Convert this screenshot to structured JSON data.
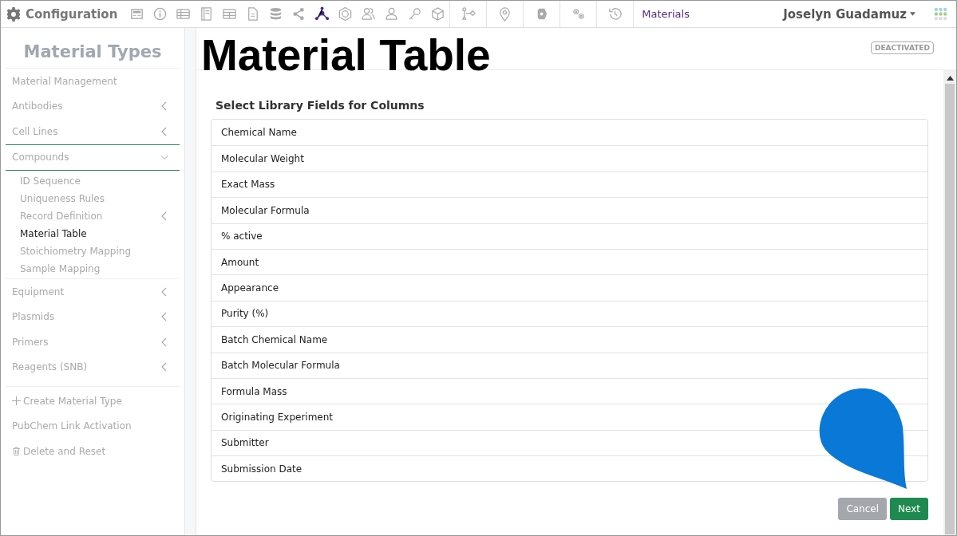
{
  "app_title": "Configuration",
  "toolbar": [
    {
      "selected": false
    },
    {
      "selected": false
    },
    {
      "selected": false
    },
    {
      "selected": false
    },
    {
      "selected": false
    },
    {
      "selected": false
    },
    {
      "selected": false
    },
    {
      "selected": false
    },
    {
      "selected": true
    },
    {
      "selected": false
    },
    {
      "selected": false
    },
    {
      "selected": false
    },
    {
      "selected": false
    },
    {
      "selected": false
    },
    {
      "selected": false
    },
    {
      "selected": false
    },
    {
      "selected": false
    },
    {
      "selected": false
    },
    {
      "selected": false
    }
  ],
  "breadcrumb": "Materials",
  "user": "Joselyn Guadamuz",
  "sidebar": {
    "title": "Material Types",
    "items": [
      {
        "label": "Material Management",
        "kind": "plain",
        "selected": false
      },
      {
        "label": "Antibodies",
        "kind": "group",
        "expanded": false,
        "selected": false
      },
      {
        "label": "Cell Lines",
        "kind": "group",
        "expanded": false,
        "selected": false
      },
      {
        "label": "Compounds",
        "kind": "group",
        "expanded": true,
        "selected": false,
        "children": [
          {
            "label": "ID Sequence",
            "kind": "plain",
            "selected": false
          },
          {
            "label": "Uniqueness Rules",
            "kind": "plain",
            "selected": false
          },
          {
            "label": "Record Definition",
            "kind": "group",
            "expanded": false,
            "selected": false
          },
          {
            "label": "Material Table",
            "kind": "plain",
            "selected": true
          },
          {
            "label": "Stoichiometry Mapping",
            "kind": "plain",
            "selected": false
          },
          {
            "label": "Sample Mapping",
            "kind": "plain",
            "selected": false
          }
        ]
      },
      {
        "label": "Equipment",
        "kind": "group",
        "expanded": false,
        "selected": false
      },
      {
        "label": "Plasmids",
        "kind": "group",
        "expanded": false,
        "selected": false
      },
      {
        "label": "Primers",
        "kind": "group",
        "expanded": false,
        "selected": false
      },
      {
        "label": "Reagents (SNB)",
        "kind": "group",
        "expanded": false,
        "selected": false
      }
    ],
    "actions": [
      {
        "label": "Create Material Type",
        "kind": "add"
      },
      {
        "label": "PubChem Link Activation",
        "kind": "plain"
      },
      {
        "label": "Delete and Reset",
        "kind": "delete"
      }
    ]
  },
  "page_title": "Material Table",
  "status_badge": "DEACTIVATED",
  "section_title": "Select Library Fields for Columns",
  "fields": [
    "Chemical Name",
    "Molecular Weight",
    "Exact Mass",
    "Molecular Formula",
    "% active",
    "Amount",
    "Appearance",
    "Purity (%)",
    "Batch Chemical Name",
    "Batch Molecular Formula",
    "Formula Mass",
    "Originating Experiment",
    "Submitter",
    "Submission Date"
  ],
  "buttons": [
    {
      "label": "Cancel",
      "kind": "secondary"
    },
    {
      "label": "Next",
      "kind": "primary"
    }
  ]
}
